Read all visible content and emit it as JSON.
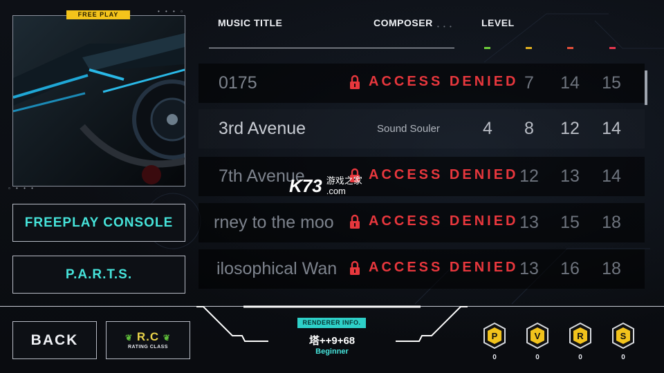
{
  "jacket": {
    "tag": "FREE PLAY"
  },
  "left_menu": {
    "freeplay_console": "FREEPLAY CONSOLE",
    "parts": "P.A.R.T.S."
  },
  "header": {
    "music_title": "MUSIC TITLE",
    "composer": "COMPOSER",
    "level": "LEVEL",
    "level_colors": [
      "#6fd13a",
      "#e5b321",
      "#e8503a",
      "#e8374f"
    ]
  },
  "songs": [
    {
      "title": "0175",
      "locked": true,
      "denied": "ACCESS DENIED",
      "levels": [
        "",
        "7",
        "14",
        "15"
      ]
    },
    {
      "title": "3rd Avenue",
      "locked": false,
      "composer": "Sound Souler",
      "levels": [
        "4",
        "8",
        "12",
        "14"
      ]
    },
    {
      "title": "7th Avenue",
      "locked": true,
      "denied": "ACCESS DENIED",
      "levels": [
        "",
        "12",
        "13",
        "14"
      ]
    },
    {
      "title": "rney to the moo",
      "locked": true,
      "denied": "ACCESS DENIED",
      "levels": [
        "",
        "13",
        "15",
        "18"
      ]
    },
    {
      "title": "ilosophical Wan",
      "locked": true,
      "denied": "ACCESS DENIED",
      "levels": [
        "",
        "13",
        "16",
        "18"
      ]
    }
  ],
  "watermark": {
    "logo": "K73",
    "cn": "游戏之家",
    "sub": ".com"
  },
  "bottom": {
    "back": "BACK",
    "rc_main": "R.C",
    "rc_sub": "RATING CLASS",
    "renderer_tag": "RENDERER INFO.",
    "renderer_name": "塔++9+68",
    "renderer_class": "Beginner"
  },
  "badges": [
    {
      "letter": "P",
      "count": "0",
      "icon": "p-badge-icon"
    },
    {
      "letter": "V",
      "count": "0",
      "icon": "v-badge-icon"
    },
    {
      "letter": "R",
      "count": "0",
      "icon": "r-badge-icon"
    },
    {
      "letter": "S",
      "count": "0",
      "icon": "s-badge-icon"
    }
  ],
  "colors": {
    "accent_cyan": "#46e3da",
    "denied_red": "#e8373d",
    "badge_yellow": "#f2c31c",
    "rc_gold": "#e9d34a"
  }
}
